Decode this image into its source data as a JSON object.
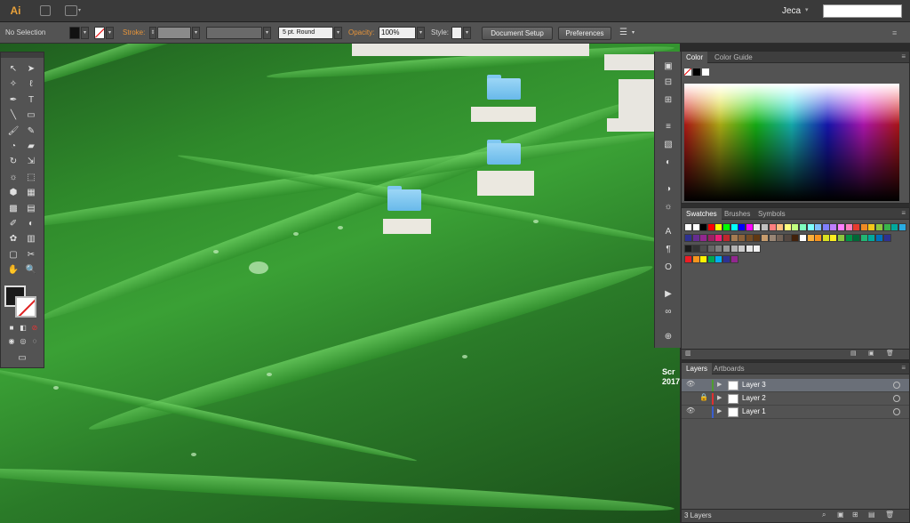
{
  "app": {
    "logo": "Ai"
  },
  "menubar": {
    "workspace": "Jeca",
    "search_value": ""
  },
  "control_bar": {
    "selection_label": "No Selection",
    "stroke_label": "Stroke:",
    "brush_value": "5 pt. Round",
    "opacity_label": "Opacity:",
    "opacity_value": "100%",
    "style_label": "Style:",
    "document_setup": "Document Setup",
    "preferences": "Preferences"
  },
  "canvas": {
    "overlay_text": "Scr\n2017"
  },
  "color_panel": {
    "tabs": [
      "Color",
      "Color Guide"
    ]
  },
  "swatches_panel": {
    "tabs": [
      "Swatches",
      "Brushes",
      "Symbols"
    ],
    "rows": [
      [
        "#ffffff",
        "#ffffff",
        "#000000",
        "#ff0000",
        "#ffff00",
        "#00ff00",
        "#00ffff",
        "#0000ff",
        "#ff00ff",
        "#e8e8e8",
        "#c0c0c0",
        "#ff7f7f",
        "#ffbf7f",
        "#ffff7f",
        "#bfff7f",
        "#7fffbf",
        "#7fffff",
        "#7fbfff",
        "#7f7fff",
        "#bf7fff",
        "#ff7fff",
        "#ff7fbf",
        "#e63b2e",
        "#f08a24",
        "#f5c518",
        "#8cc63f",
        "#39b54a",
        "#00a99d",
        "#29abe2"
      ],
      [
        "#2e3192",
        "#662d91",
        "#92278f",
        "#9e1f63",
        "#ed1e79",
        "#c1272d",
        "#a67c52",
        "#8c6239",
        "#754c24",
        "#603813",
        "#c69c6d",
        "#998675",
        "#736357",
        "#534741",
        "#42210b",
        "#ffffff",
        "#fbb03b",
        "#f7931e",
        "#d9e021",
        "#fcee21",
        "#8cc63f",
        "#009245",
        "#006837",
        "#22b573",
        "#00a99d",
        "#0071bc",
        "#2e3192"
      ],
      [
        "#1a1a1a",
        "#333333",
        "#4d4d4d",
        "#666666",
        "#808080",
        "#999999",
        "#b3b3b3",
        "#cccccc",
        "#e6e6e6",
        "#f2f2f2"
      ],
      [
        "#ed1c24",
        "#f7941d",
        "#fff200",
        "#00a651",
        "#00aeef",
        "#2e3192",
        "#92278f"
      ]
    ]
  },
  "layers_panel": {
    "tabs": [
      "Layers",
      "Artboards"
    ],
    "layers": [
      {
        "name": "Layer 3",
        "color": "#4f9c2f",
        "selected": true
      },
      {
        "name": "Layer 2",
        "color": "#e03030",
        "selected": false
      },
      {
        "name": "Layer 1",
        "color": "#3a5fd0",
        "selected": false
      }
    ],
    "count": "3 Layers"
  },
  "icons": {
    "tools": [
      "selection-tool",
      "direct-selection-tool",
      "magic-wand-tool",
      "lasso-tool",
      "pen-tool",
      "type-tool",
      "line-tool",
      "rectangle-tool",
      "paintbrush-tool",
      "pencil-tool",
      "blob-brush-tool",
      "eraser-tool",
      "rotate-tool",
      "scale-tool",
      "warp-tool",
      "free-transform-tool",
      "shape-builder-tool",
      "perspective-grid-tool",
      "mesh-tool",
      "gradient-tool",
      "eyedropper-tool",
      "blend-tool",
      "symbol-sprayer-tool",
      "column-graph-tool",
      "artboard-tool",
      "slice-tool",
      "hand-tool",
      "zoom-tool"
    ],
    "strip": [
      "artboard-icon",
      "align-icon",
      "transform-icon",
      "stroke-icon",
      "gradient-icon",
      "transparency-icon",
      "appearance-icon",
      "graphic-styles-icon",
      "character-icon",
      "paragraph-icon",
      "opentype-icon",
      "actions-icon",
      "links-icon",
      "navigator-icon"
    ]
  }
}
